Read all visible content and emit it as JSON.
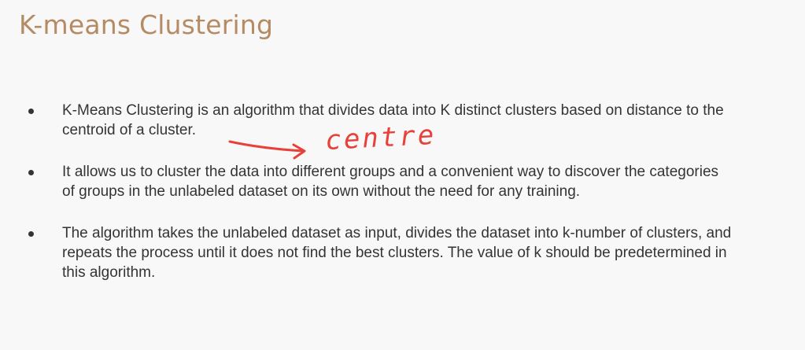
{
  "slide": {
    "title": "K-means Clustering",
    "bullets": [
      "K-Means Clustering is an algorithm that divides data into K distinct clusters based on distance to the centroid of a cluster.",
      "It allows us to cluster the data into different groups and a convenient way to discover the categories of groups in the unlabeled dataset on its own without the need for any training.",
      "The algorithm takes the unlabeled dataset as input, divides the dataset into k-number of clusters, and repeats the process until it does not find the best clusters. The value of k should be predetermined in this algorithm."
    ],
    "annotation": {
      "text": "centre",
      "color": "#e8413a"
    }
  }
}
